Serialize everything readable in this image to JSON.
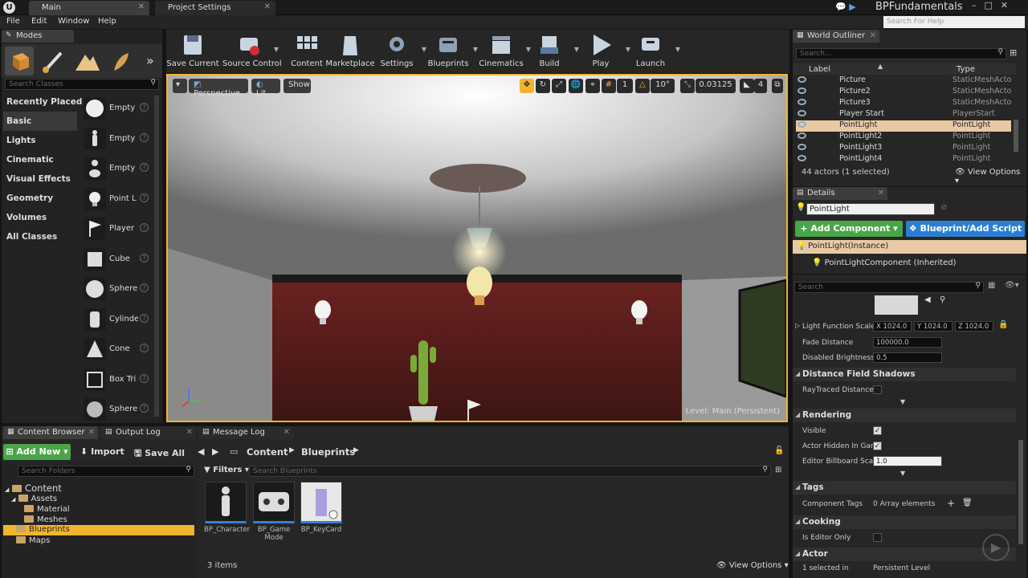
{
  "titlebar": {
    "tabs": [
      {
        "label": "Main"
      },
      {
        "label": "Project Settings"
      }
    ],
    "project_name": "BPFundamentals",
    "help_search_placeholder": "Search For Help"
  },
  "menu": [
    "File",
    "Edit",
    "Window",
    "Help"
  ],
  "modes": {
    "title": "Modes",
    "search_placeholder": "Search Classes",
    "categories": [
      "Recently Placed",
      "Basic",
      "Lights",
      "Cinematic",
      "Visual Effects",
      "Geometry",
      "Volumes",
      "All Classes"
    ],
    "selected_category": "Basic",
    "items": [
      "Empty",
      "Empty",
      "Empty",
      "Point L",
      "Player",
      "Cube",
      "Sphere",
      "Cylinde",
      "Cone",
      "Box Tri",
      "Sphere"
    ]
  },
  "toolbar": {
    "buttons": [
      {
        "label": "Save Current",
        "icon": "save-icon"
      },
      {
        "label": "Source Control",
        "icon": "source-control-icon"
      },
      {
        "label": "Content",
        "icon": "content-icon"
      },
      {
        "label": "Marketplace",
        "icon": "marketplace-icon"
      },
      {
        "label": "Settings",
        "icon": "settings-icon"
      },
      {
        "label": "Blueprints",
        "icon": "blueprints-icon"
      },
      {
        "label": "Cinematics",
        "icon": "cinematics-icon"
      },
      {
        "label": "Build",
        "icon": "build-icon"
      },
      {
        "label": "Play",
        "icon": "play-icon"
      },
      {
        "label": "Launch",
        "icon": "launch-icon"
      }
    ]
  },
  "viewport": {
    "view_mode": "Perspective",
    "lit_mode": "Lit",
    "show_label": "Show",
    "grid_snap": "1",
    "angle_snap": "10°",
    "scale_snap": "0.03125",
    "camera_speed": "4",
    "level_label": "Level:",
    "level_name": "Main (Persistent)",
    "accent": "#f2b42f"
  },
  "outliner": {
    "title": "World Outliner",
    "search_placeholder": "Search...",
    "col_label": "Label",
    "col_type": "Type",
    "rows": [
      {
        "name": "Picture",
        "type": "StaticMeshActor"
      },
      {
        "name": "Picture2",
        "type": "StaticMeshActor"
      },
      {
        "name": "Picture3",
        "type": "StaticMeshActor"
      },
      {
        "name": "Player Start",
        "type": "PlayerStart"
      },
      {
        "name": "PointLight",
        "type": "PointLight"
      },
      {
        "name": "PointLight2",
        "type": "PointLight"
      },
      {
        "name": "PointLight3",
        "type": "PointLight"
      },
      {
        "name": "PointLight4",
        "type": "PointLight"
      }
    ],
    "selected_row": "PointLight",
    "summary": "44 actors (1 selected)",
    "view_options": "View Options"
  },
  "details": {
    "title": "Details",
    "name_value": "PointLight",
    "add_component": "+ Add Component",
    "blueprint_script": "Blueprint/Add Script",
    "instance_row": "PointLight(Instance)",
    "component_row": "PointLightComponent (Inherited)",
    "search_placeholder": "Search",
    "light_function_scale": {
      "label": "Light Function Scale",
      "x": "X 1024.0",
      "y": "Y 1024.0",
      "z": "Z 1024.0"
    },
    "fade_distance": {
      "label": "Fade Distance",
      "value": "100000.0"
    },
    "disabled_brightness": {
      "label": "Disabled Brightness",
      "value": "0.5"
    },
    "sections": {
      "dfs": "Distance Field Shadows",
      "rendering": "Rendering",
      "tags": "Tags",
      "cooking": "Cooking",
      "actor": "Actor"
    },
    "raytraced_label": "RayTraced DistanceI",
    "visible_label": "Visible",
    "hidden_label": "Actor Hidden In Gam",
    "billboard_label": "Editor Billboard Scal",
    "billboard_value": "1.0",
    "component_tags_label": "Component Tags",
    "component_tags_value": "0 Array elements",
    "editor_only_label": "Is Editor Only",
    "selected_in_label": "1 selected in",
    "selected_in_value": "Persistent Level"
  },
  "content_browser": {
    "tabs": [
      "Content Browser",
      "Output Log",
      "Message Log"
    ],
    "add_new": "Add New",
    "import": "Import",
    "save_all": "Save All",
    "breadcrumb": [
      "Content",
      "Blueprints"
    ],
    "folder_search_placeholder": "Search Folders",
    "filters": "Filters",
    "asset_search_placeholder": "Search Blueprints",
    "tree": [
      "Content",
      "Assets",
      "Material",
      "Meshes",
      "Blueprints",
      "Maps"
    ],
    "selected_folder": "Blueprints",
    "assets": [
      {
        "name": "BP_Character"
      },
      {
        "name": "BP_Game Mode"
      },
      {
        "name": "BP_KeyCard"
      }
    ],
    "item_count": "3 items",
    "view_options": "View Options"
  }
}
